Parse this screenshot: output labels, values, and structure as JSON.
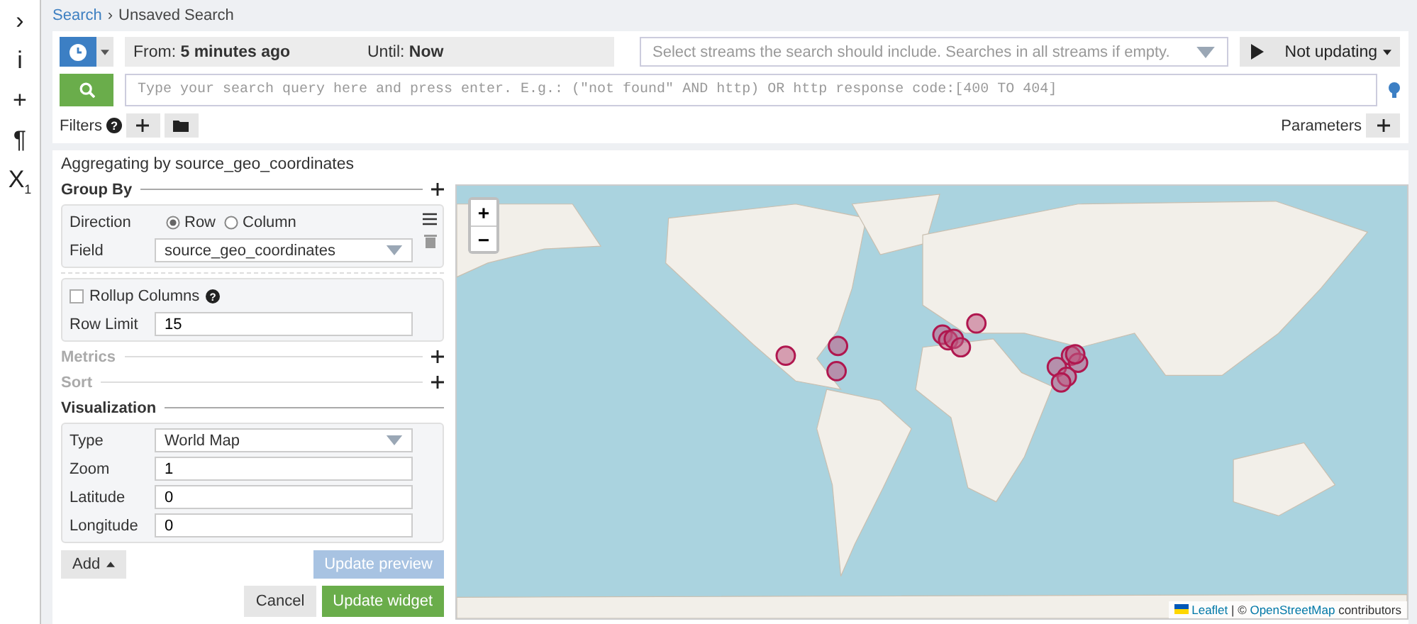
{
  "sidebar": {
    "items": [
      {
        "glyph": "›"
      },
      {
        "glyph": "i"
      },
      {
        "glyph": "+"
      },
      {
        "glyph": "¶"
      },
      {
        "glyph": "X$_{1}$"
      }
    ]
  },
  "breadcrumb": {
    "parts": [
      {
        "label": "Search",
        "link": true
      },
      {
        "label": "Unsaved Search",
        "link": false
      }
    ],
    "separator": "›"
  },
  "time_range": {
    "from_label": "From:",
    "from_value": "5 minutes ago",
    "until_label": "Until:",
    "until_value": "Now"
  },
  "streams": {
    "placeholder": "Select streams the search should include. Searches in all streams if empty."
  },
  "refresh": {
    "label": "Not updating"
  },
  "query": {
    "placeholder": "Type your search query here and press enter. E.g.: (\"not found\" AND http) OR http response code:[400 TO 404]"
  },
  "filters": {
    "label": "Filters",
    "help": "?"
  },
  "parameters": {
    "label": "Parameters"
  },
  "widget": {
    "title": "Aggregating by source_geo_coordinates",
    "group_by": {
      "title": "Group By",
      "direction_label": "Direction",
      "directions": [
        {
          "label": "Row",
          "selected": true
        },
        {
          "label": "Column",
          "selected": false
        }
      ],
      "field_label": "Field",
      "field_value": "source_geo_coordinates",
      "rollup": {
        "label": "Rollup Columns",
        "checked": false,
        "help": "?"
      },
      "row_limit_label": "Row Limit",
      "row_limit": "15"
    },
    "metrics": {
      "title": "Metrics"
    },
    "sort": {
      "title": "Sort"
    },
    "visualization": {
      "title": "Visualization",
      "fields": [
        {
          "kind": "select",
          "label": "Type",
          "value": "World Map"
        },
        {
          "kind": "input",
          "label": "Zoom",
          "value": "1"
        },
        {
          "kind": "input",
          "label": "Latitude",
          "value": "0"
        },
        {
          "kind": "input",
          "label": "Longitude",
          "value": "0"
        }
      ]
    },
    "add_button": "Add",
    "update_preview": {
      "label": "Update preview",
      "disabled": true
    },
    "cancel_button": "Cancel",
    "update_widget_button": "Update widget"
  },
  "map": {
    "zoom_in": "+",
    "zoom_out": "−",
    "attribution": [
      {
        "text": "Leaflet",
        "link": true
      },
      {
        "text": " | © ",
        "link": false
      },
      {
        "text": "OpenStreetMap",
        "link": true
      },
      {
        "text": " contributors",
        "link": false
      }
    ]
  }
}
